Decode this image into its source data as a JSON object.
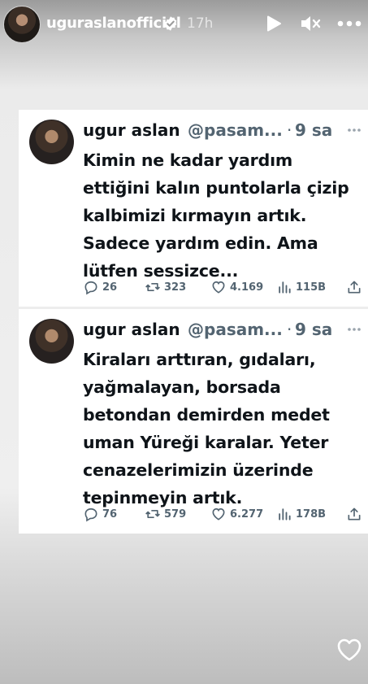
{
  "story": {
    "username": "uguraslanofficial",
    "time": "17h",
    "icons": [
      "verified-badge-icon",
      "play-icon",
      "mute-icon",
      "more-icon",
      "heart-icon"
    ]
  },
  "tweets": [
    {
      "name": "ugur aslan",
      "handle": "@pasam...",
      "dot": "·",
      "time": "9 sa",
      "lines": [
        "Kimin ne kadar yardım",
        "ettiğini kalın puntolarla çizip",
        "kalbimizi kırmayın artık.",
        "Sadece yardım edin. Ama",
        "lütfen sessizce..."
      ],
      "replies": "26",
      "retweets": "323",
      "likes": "4.169",
      "views": "115B"
    },
    {
      "name": "ugur aslan",
      "handle": "@pasam...",
      "dot": "·",
      "time": "9 sa",
      "lines": [
        "Kiraları arttıran, gıdaları,",
        "yağmalayan, borsada",
        "betondan demirden medet",
        "uman Yüreği karalar. Yeter",
        "cenazelerimizin üzerinde",
        "tepinmeyin artık."
      ],
      "replies": "76",
      "retweets": "579",
      "likes": "6.277",
      "views": "178B"
    }
  ]
}
